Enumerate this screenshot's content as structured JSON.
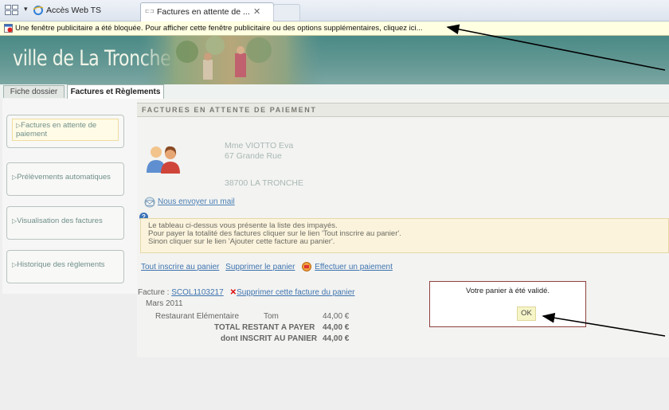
{
  "browser": {
    "tab_inactive_label": "Accès Web TS",
    "tab_active_label": "Factures en attente de ...",
    "tab_close": "✕",
    "tab_dropdown": "▾"
  },
  "infobar": {
    "message": "Une fenêtre publicitaire a été bloquée. Pour afficher cette fenêtre publicitaire ou des options supplémentaires, cliquez ici..."
  },
  "site": {
    "title": "ville de La Tronche"
  },
  "nav_tabs": {
    "dossier": "Fiche dossier",
    "factures": "Factures et Règlements"
  },
  "sidebar": {
    "items": [
      {
        "label": "Factures en attente de paiement"
      },
      {
        "label": "Prélèvements automatiques"
      },
      {
        "label": "Visualisation des factures"
      },
      {
        "label": "Historique des règlements"
      }
    ]
  },
  "main": {
    "section_title": "FACTURES EN ATTENTE DE PAIEMENT",
    "address": {
      "name": "Mme VIOTTO Eva",
      "street": "67 Grande Rue",
      "city": "38700 LA TRONCHE"
    },
    "mail_link": "Nous envoyer un mail",
    "info_lines": [
      "Le tableau ci-dessus vous présente la liste des impayés.",
      "Pour payer la totalité des factures cliquer sur le lien 'Tout inscrire au panier'.",
      "Sinon cliquer sur le lien 'Ajouter cette facture au panier'."
    ],
    "actions": {
      "add_all": "Tout inscrire au panier",
      "remove_cart": "Supprimer le panier",
      "pay": "Effectuer un paiement"
    },
    "invoice": {
      "prefix": "Facture : ",
      "number": "SCOL1103217",
      "remove_mark": "✕",
      "remove_label": "Supprimer cette facture du panier",
      "month": "Mars 2011",
      "service": "Restaurant Elémentaire",
      "child": "Tom",
      "amount": "44,00 €",
      "total_label": "TOTAL RESTANT A PAYER",
      "total_amount": "44,00 €",
      "cart_label": "dont INSCRIT AU PANIER",
      "cart_amount": "44,00 €"
    }
  },
  "dialog": {
    "message": "Votre panier à été validé.",
    "ok_label": "OK"
  }
}
